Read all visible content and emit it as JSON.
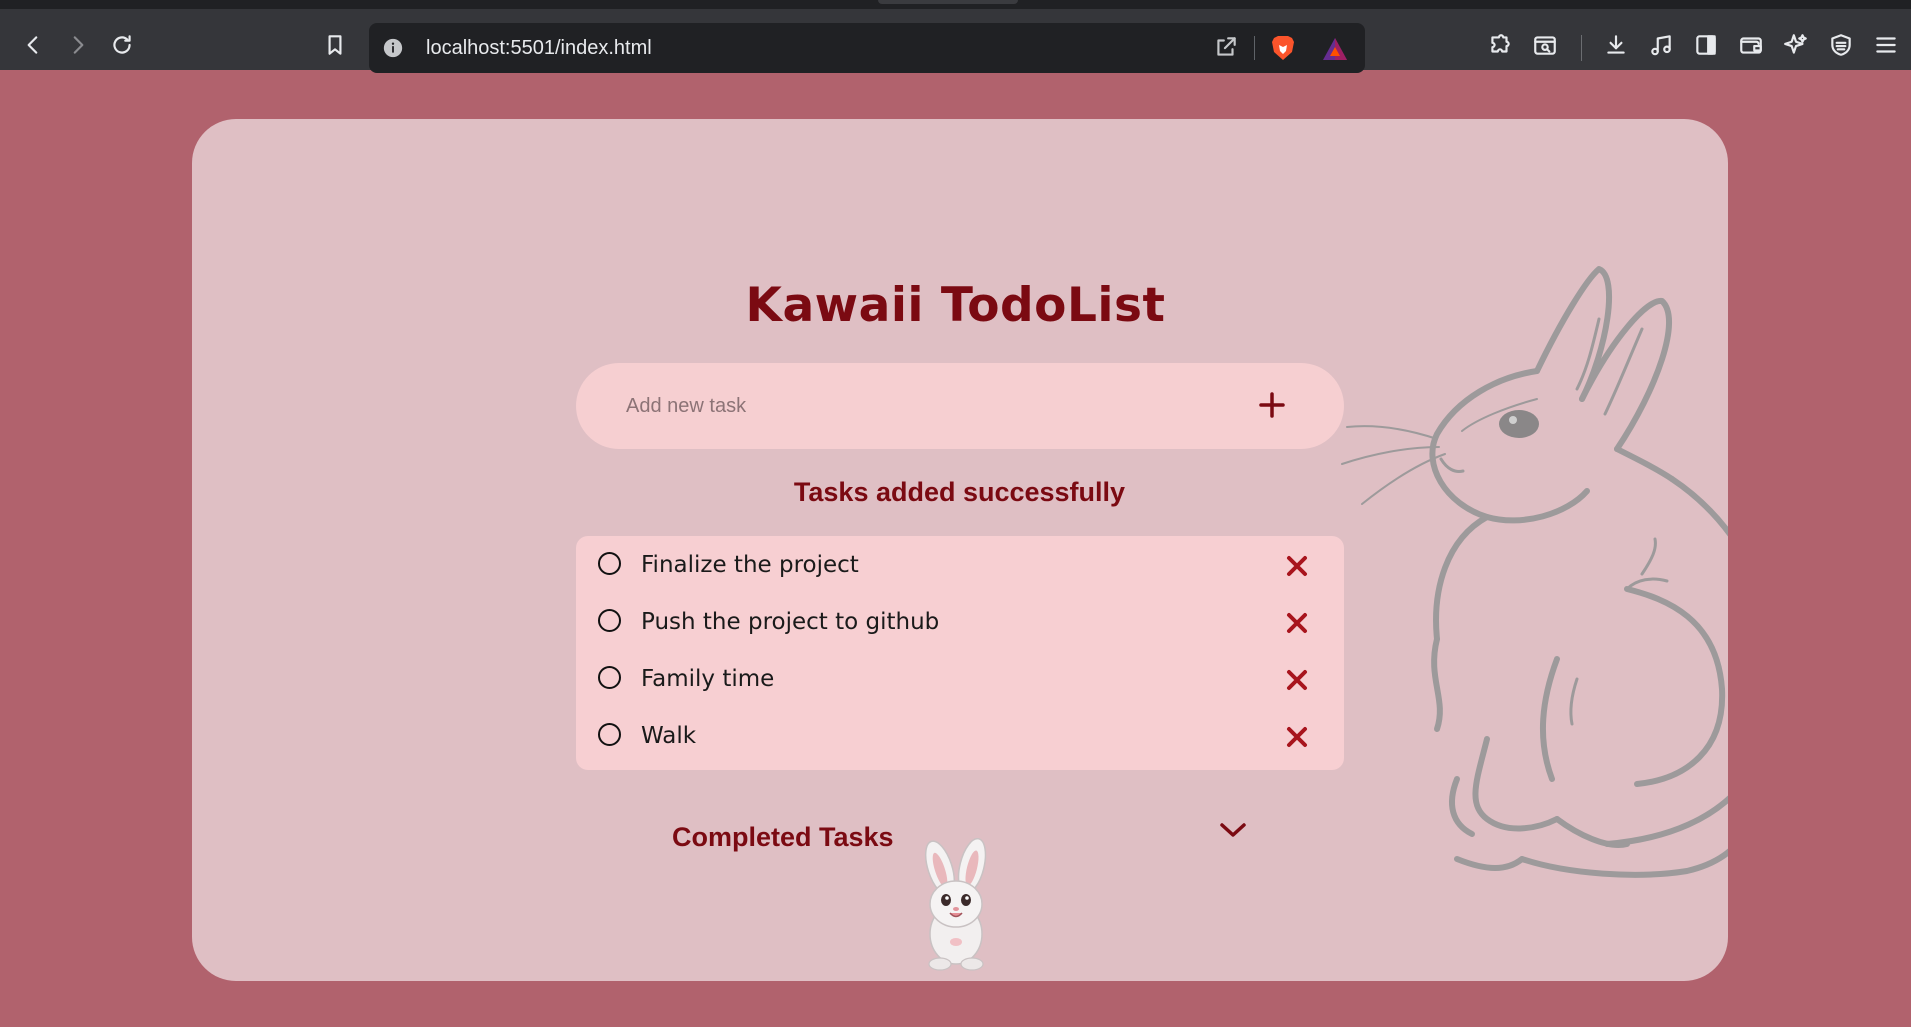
{
  "browser": {
    "url": "localhost:5501/index.html",
    "icons": [
      "back-icon",
      "forward-icon",
      "reload-icon",
      "bookmark-icon",
      "info-icon",
      "share-icon",
      "brave-shields-icon",
      "brave-rewards-icon",
      "extensions-icon",
      "reader-mode-icon",
      "download-icon",
      "media-icon",
      "sidebar-icon",
      "wallet-icon",
      "leo-ai-icon",
      "vpn-icon",
      "menu-icon"
    ]
  },
  "app": {
    "title": "Kawaii TodoList",
    "input_placeholder": "Add new task",
    "add_icon": "plus-icon",
    "status_message": "Tasks added successfully",
    "tasks": [
      {
        "label": "Finalize the project",
        "done": false
      },
      {
        "label": "Push the project to github",
        "done": false
      },
      {
        "label": "Family time",
        "done": false
      },
      {
        "label": "Walk",
        "done": false
      }
    ],
    "completed_heading": "Completed Tasks",
    "expand_icon": "chevron-down-icon"
  },
  "colors": {
    "page_bg": "#b1626d",
    "card_bg": "#dfbfc4",
    "accent": "#7b0a12",
    "list_bg": "#f7cfd2",
    "delete": "#a8141d"
  }
}
